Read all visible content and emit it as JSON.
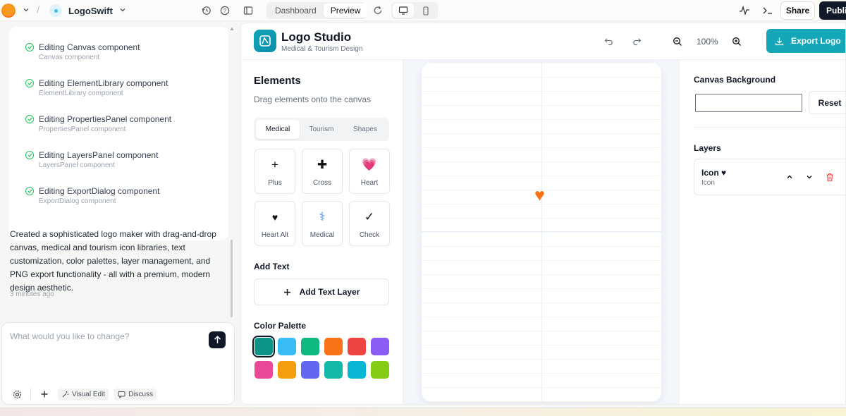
{
  "topbar": {
    "project_name": "LogoSwift",
    "view_tabs": [
      "Dashboard",
      "Preview"
    ],
    "active_view": "Preview",
    "share_label": "Share",
    "publish_label": "Publish"
  },
  "chat": {
    "steps": [
      {
        "title": "Editing Canvas component",
        "sub": "Canvas component"
      },
      {
        "title": "Editing ElementLibrary component",
        "sub": "ElementLibrary component"
      },
      {
        "title": "Editing PropertiesPanel component",
        "sub": "PropertiesPanel component"
      },
      {
        "title": "Editing LayersPanel component",
        "sub": "LayersPanel component"
      },
      {
        "title": "Editing ExportDialog component",
        "sub": "ExportDialog component"
      }
    ],
    "summary": "Created a sophisticated logo maker with drag-and-drop canvas, medical and tourism icon libraries, text customization, color palettes, layer management, and PNG export functionality - all with a premium, modern design aesthetic.",
    "time_ago": "3 minutes ago",
    "input_placeholder": "What would you like to change?",
    "visual_edit_label": "Visual Edit",
    "discuss_label": "Discuss"
  },
  "app": {
    "title": "Logo Studio",
    "subtitle": "Medical & Tourism Design",
    "zoom": "100%",
    "export_label": "Export Logo",
    "elements": {
      "title": "Elements",
      "subtitle": "Drag elements onto the canvas",
      "tabs": [
        "Medical",
        "Tourism",
        "Shapes"
      ],
      "active_tab": "Medical",
      "items": [
        {
          "glyph": "+",
          "label": "Plus"
        },
        {
          "glyph": "✚",
          "label": "Cross"
        },
        {
          "glyph": "💗",
          "label": "Heart"
        },
        {
          "glyph": "♥",
          "label": "Heart Alt"
        },
        {
          "glyph": "⚕",
          "label": "Medical"
        },
        {
          "glyph": "✓",
          "label": "Check"
        }
      ],
      "add_text_title": "Add Text",
      "add_text_button": "Add Text Layer",
      "palette_title": "Color Palette",
      "palette": [
        "#0d9488",
        "#38bdf8",
        "#10b981",
        "#f97316",
        "#ef4444",
        "#8b5cf6",
        "#ec4899",
        "#f59e0b",
        "#6366f1",
        "#14b8a6",
        "#06b6d4",
        "#84cc16"
      ]
    },
    "canvas": {
      "element_glyph": "♥",
      "element_color": "#f97316"
    },
    "properties": {
      "bg_label": "Canvas Background",
      "reset_label": "Reset",
      "layers_label": "Layers",
      "layers": [
        {
          "name": "Icon ♥",
          "type": "Icon"
        }
      ]
    }
  }
}
